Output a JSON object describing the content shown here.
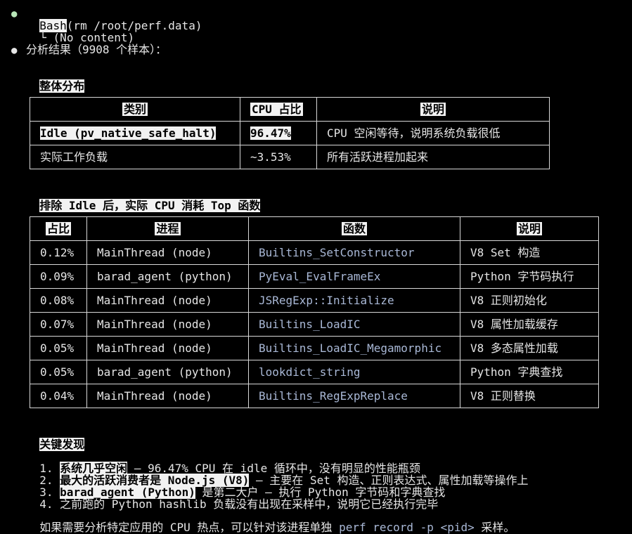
{
  "bash": {
    "name": "Bash",
    "cmd": "(rm /root/perf.data)",
    "result_prefix": "└",
    "result": "(No content)"
  },
  "summary": {
    "title": "分析结果（9908 个样本）："
  },
  "section1": {
    "heading": "整体分布",
    "headers": [
      "类别",
      "CPU 占比",
      "说明"
    ],
    "rows": [
      [
        "Idle (pv_native_safe_halt)",
        "96.47%",
        "CPU 空闲等待，说明系统负载很低"
      ],
      [
        "实际工作负载",
        "~3.53%",
        "所有活跃进程加起来"
      ]
    ]
  },
  "section2": {
    "heading": "排除 Idle 后，实际 CPU 消耗 Top 函数",
    "headers": [
      "占比",
      "进程",
      "函数",
      "说明"
    ],
    "rows": [
      [
        "0.12%",
        "MainThread (node)",
        "Builtins_SetConstructor",
        "V8 Set 构造"
      ],
      [
        "0.09%",
        "barad_agent (python)",
        "PyEval_EvalFrameEx",
        "Python 字节码执行"
      ],
      [
        "0.08%",
        "MainThread (node)",
        "JSRegExp::Initialize",
        "V8 正则初始化"
      ],
      [
        "0.07%",
        "MainThread (node)",
        "Builtins_LoadIC",
        "V8 属性加载缓存"
      ],
      [
        "0.05%",
        "MainThread (node)",
        "Builtins_LoadIC_Megamorphic",
        "V8 多态属性加载"
      ],
      [
        "0.05%",
        "barad_agent (python)",
        "lookdict_string",
        "Python 字典查找"
      ],
      [
        "0.04%",
        "MainThread (node)",
        "Builtins_RegExpReplace",
        "V8 正则替换"
      ]
    ]
  },
  "findings": {
    "heading": "关键发现",
    "items": [
      {
        "num": "1.",
        "bold": "系统几乎空闲",
        "rest": " — 96.47% CPU 在 idle 循环中，没有明显的性能瓶颈"
      },
      {
        "num": "2.",
        "bold": "最大的活跃消费者是 Node.js (V8)",
        "rest": " — 主要在 Set 构造、正则表达式、属性加载等操作上"
      },
      {
        "num": "3.",
        "bold": "barad_agent (Python)",
        "rest": " 是第二大户 — 执行 Python 字节码和字典查找"
      },
      {
        "num": "4.",
        "bold": "",
        "rest": "之前跑的 Python hashlib 负载没有出现在采样中，说明它已经执行完毕"
      }
    ],
    "footer_pre": "如果需要分析特定应用的 CPU 热点，可以针对该进程单独 ",
    "footer_code": "perf record -p <pid>",
    "footer_post": " 采样。"
  }
}
